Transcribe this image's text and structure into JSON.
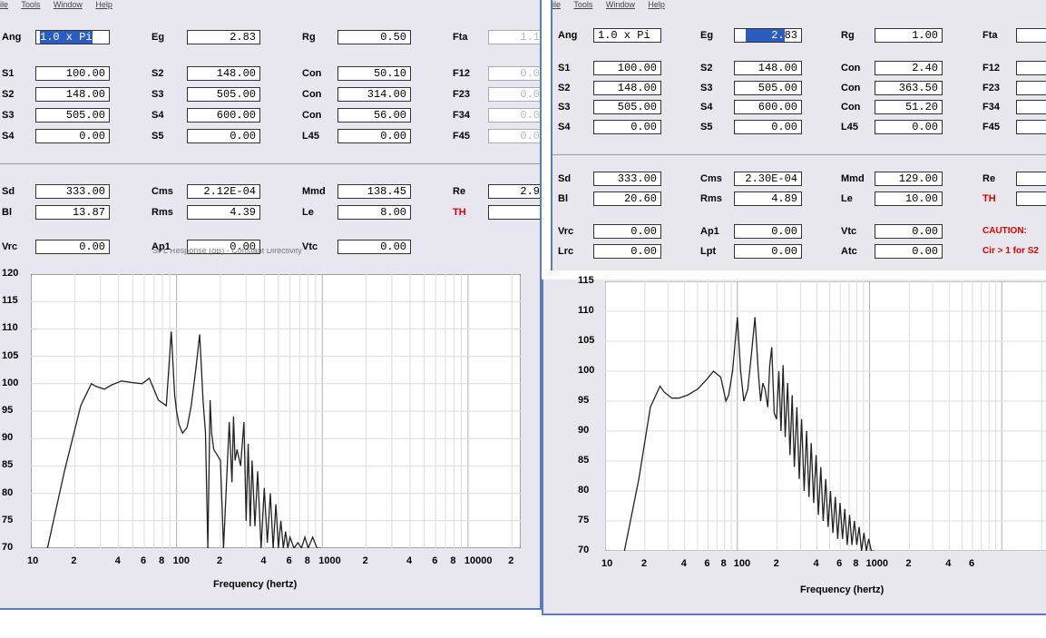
{
  "left": {
    "menu": [
      "ile",
      "Tools",
      "Window",
      "Help"
    ],
    "row0": {
      "ang_label": "Ang",
      "ang": "1.0 x Pi",
      "eg_label": "Eg",
      "eg": "2.83",
      "rg_label": "Rg",
      "rg": "0.50",
      "fta_label": "Fta",
      "fta": "1.1"
    },
    "rows": [
      {
        "a": "S1",
        "av": "100.00",
        "b": "S2",
        "bv": "148.00",
        "c": "Con",
        "cv": "50.10",
        "d": "F12",
        "dv": "0.0"
      },
      {
        "a": "S2",
        "av": "148.00",
        "b": "S3",
        "bv": "505.00",
        "c": "Con",
        "cv": "314.00",
        "d": "F23",
        "dv": "0.0"
      },
      {
        "a": "S3",
        "av": "505.00",
        "b": "S4",
        "bv": "600.00",
        "c": "Con",
        "cv": "56.00",
        "d": "F34",
        "dv": "0.0"
      },
      {
        "a": "S4",
        "av": "0.00",
        "b": "S5",
        "bv": "0.00",
        "c": "L45",
        "cv": "0.00",
        "d": "F45",
        "dv": "0.0"
      }
    ],
    "params": [
      {
        "a": "Sd",
        "av": "333.00",
        "b": "Cms",
        "bv": "2.12E-04",
        "c": "Mmd",
        "cv": "138.45",
        "d": "Re",
        "dv": "2.9"
      },
      {
        "a": "Bl",
        "av": "13.87",
        "b": "Rms",
        "bv": "4.39",
        "c": "Le",
        "cv": "8.00",
        "d": "TH",
        "dv": ""
      }
    ],
    "vrc": {
      "a": "Vrc",
      "av": "0.00",
      "b": "Ap1",
      "bv": "0.00",
      "c": "Vtc",
      "cv": "0.00"
    },
    "chart_title_partial": "SPL Response (dB) - Constant Directivity",
    "xtitle": "Frequency (hertz)"
  },
  "right": {
    "menu": [
      "ile",
      "Tools",
      "Window",
      "Help"
    ],
    "row0": {
      "ang_label": "Ang",
      "ang": "1.0 x Pi",
      "eg_label": "Eg",
      "eg_sel": "2.",
      "eg_rest": "83",
      "rg_label": "Rg",
      "rg": "1.00",
      "fta_label": "Fta"
    },
    "rows": [
      {
        "a": "S1",
        "av": "100.00",
        "b": "S2",
        "bv": "148.00",
        "c": "Con",
        "cv": "2.40",
        "d": "F12"
      },
      {
        "a": "S2",
        "av": "148.00",
        "b": "S3",
        "bv": "505.00",
        "c": "Con",
        "cv": "363.50",
        "d": "F23"
      },
      {
        "a": "S3",
        "av": "505.00",
        "b": "S4",
        "bv": "600.00",
        "c": "Con",
        "cv": "51.20",
        "d": "F34"
      },
      {
        "a": "S4",
        "av": "0.00",
        "b": "S5",
        "bv": "0.00",
        "c": "L45",
        "cv": "0.00",
        "d": "F45"
      }
    ],
    "params": [
      {
        "a": "Sd",
        "av": "333.00",
        "b": "Cms",
        "bv": "2.30E-04",
        "c": "Mmd",
        "cv": "129.00",
        "d": "Re"
      },
      {
        "a": "Bl",
        "av": "20.60",
        "b": "Rms",
        "bv": "4.89",
        "c": "Le",
        "cv": "10.00",
        "d": "TH"
      }
    ],
    "extra": [
      {
        "a": "Vrc",
        "av": "0.00",
        "b": "Ap1",
        "bv": "0.00",
        "c": "Vtc",
        "cv": "0.00",
        "d": "CAUTION:"
      },
      {
        "a": "Lrc",
        "av": "0.00",
        "b": "Lpt",
        "bv": "0.00",
        "c": "Atc",
        "cv": "0.00",
        "d": "Cir > 1 for S2"
      }
    ],
    "xtitle": "Frequency (hertz)"
  },
  "chart_data": [
    {
      "type": "line",
      "xscale": "log",
      "ylim": [
        70,
        120
      ],
      "yticks": [
        "120",
        "115",
        "110",
        "105",
        "100",
        "95",
        "90",
        "85",
        "80",
        "75",
        "70"
      ],
      "xticks": [
        "10",
        "2",
        "4",
        "6",
        "8",
        "100",
        "2",
        "4",
        "6",
        "8",
        "1000",
        "2",
        "4",
        "6",
        "8",
        "10000",
        "2"
      ],
      "xlabel": "Frequency (hertz)",
      "series": [
        {
          "x": [
            13,
            17,
            22,
            26,
            28,
            32,
            36,
            42,
            50,
            58,
            65,
            75,
            85,
            92,
            97,
            100,
            104,
            110,
            118,
            126,
            136,
            144,
            148,
            152,
            158,
            164,
            170,
            174,
            180,
            190,
            200,
            210,
            230,
            240,
            246,
            252,
            260,
            275,
            290,
            300,
            310,
            320,
            330,
            345,
            360,
            380,
            400,
            420,
            440,
            460,
            480,
            500,
            520,
            540,
            560,
            580,
            600,
            640,
            680,
            720,
            760,
            800,
            860,
            920,
            980
          ],
          "y": [
            70,
            84,
            96,
            100,
            99.5,
            99,
            99.8,
            100.5,
            100.2,
            100,
            101,
            97,
            96,
            109.5,
            98,
            95,
            92.5,
            91,
            92,
            96,
            103,
            109,
            103,
            97,
            91,
            70,
            97,
            91,
            88,
            87,
            86,
            70,
            93,
            82,
            94,
            86,
            88,
            85,
            93,
            75,
            89,
            74,
            86,
            74,
            84,
            70,
            81,
            71,
            80,
            70,
            78,
            70,
            75,
            70,
            73,
            70,
            72,
            70,
            71,
            70,
            72,
            70,
            72,
            70,
            70
          ]
        }
      ]
    },
    {
      "type": "line",
      "xscale": "log",
      "ylim": [
        70,
        115
      ],
      "yticks": [
        "115",
        "110",
        "105",
        "100",
        "95",
        "90",
        "85",
        "80",
        "75",
        "70"
      ],
      "xticks": [
        "10",
        "2",
        "4",
        "6",
        "8",
        "100",
        "2",
        "4",
        "6",
        "8",
        "1000",
        "2",
        "4",
        "6"
      ],
      "xlabel": "Frequency (hertz)",
      "series": [
        {
          "x": [
            14,
            18,
            22,
            26,
            28,
            32,
            36,
            42,
            50,
            58,
            66,
            75,
            82,
            86,
            92,
            100,
            106,
            112,
            120,
            128,
            136,
            144,
            150,
            156,
            162,
            170,
            176,
            182,
            190,
            198,
            206,
            214,
            222,
            230,
            240,
            250,
            260,
            270,
            282,
            294,
            306,
            320,
            334,
            348,
            362,
            378,
            394,
            410,
            428,
            446,
            466,
            486,
            506,
            528,
            550,
            574,
            598,
            624,
            650,
            678,
            706,
            736,
            768,
            800,
            834,
            870,
            906,
            946,
            986,
            1030,
            1080
          ],
          "y": [
            70,
            82,
            94,
            97.5,
            96.5,
            95.5,
            95.5,
            96,
            97,
            98.5,
            100,
            99,
            95,
            96,
            100,
            109,
            100,
            95,
            97,
            103,
            109,
            100,
            95,
            98,
            97,
            94,
            101,
            104,
            93,
            92,
            100,
            90,
            101,
            89,
            98,
            86,
            96,
            84,
            94,
            82,
            92,
            80,
            90,
            79,
            88,
            78,
            86,
            76,
            84,
            75,
            82,
            74,
            80,
            73,
            79,
            72,
            78,
            72,
            77,
            71,
            76,
            71,
            75,
            71,
            74,
            70,
            73,
            70,
            72,
            70,
            70
          ]
        }
      ]
    }
  ]
}
